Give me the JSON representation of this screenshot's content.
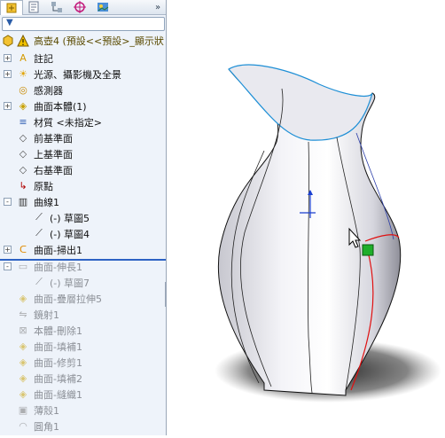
{
  "tree": {
    "root": "高壺4 (預設<<預設>_顯示狀",
    "items": [
      {
        "label": "註記",
        "icon": "A",
        "expand": "+"
      },
      {
        "label": "光源、攝影機及全景",
        "icon": "☀",
        "expand": "+"
      },
      {
        "label": "感測器",
        "icon": "◎",
        "expand": ""
      },
      {
        "label": "曲面本體(1)",
        "icon": "◈",
        "expand": "+"
      },
      {
        "label": "材質 <未指定>",
        "icon": "≡",
        "expand": ""
      },
      {
        "label": "前基準面",
        "icon": "◇",
        "expand": ""
      },
      {
        "label": "上基準面",
        "icon": "◇",
        "expand": ""
      },
      {
        "label": "右基準面",
        "icon": "◇",
        "expand": ""
      },
      {
        "label": "原點",
        "icon": "↳",
        "expand": ""
      },
      {
        "label": "曲線1",
        "icon": "▥",
        "expand": "-"
      },
      {
        "label": "(-) 草圖5",
        "icon": "⟋",
        "expand": ""
      },
      {
        "label": "(-) 草圖4",
        "icon": "⟋",
        "expand": ""
      },
      {
        "label": "曲面-掃出1",
        "icon": "ᑕ",
        "expand": "+"
      }
    ],
    "suppressed": [
      {
        "label": "曲面-伸長1",
        "icon": "▭",
        "expand": "-"
      },
      {
        "label": "(-) 草圖7",
        "icon": "⟋",
        "expand": ""
      },
      {
        "label": "曲面-疊層拉伸5",
        "icon": "◈",
        "expand": ""
      },
      {
        "label": "鏡射1",
        "icon": "⇋",
        "expand": ""
      },
      {
        "label": "本體-刪除1",
        "icon": "⊠",
        "expand": ""
      },
      {
        "label": "曲面-填補1",
        "icon": "◈",
        "expand": ""
      },
      {
        "label": "曲面-修剪1",
        "icon": "◈",
        "expand": ""
      },
      {
        "label": "曲面-填補2",
        "icon": "◈",
        "expand": ""
      },
      {
        "label": "曲面-縫織1",
        "icon": "◈",
        "expand": ""
      },
      {
        "label": "薄殼1",
        "icon": "▣",
        "expand": ""
      },
      {
        "label": "圓角1",
        "icon": "◠",
        "expand": ""
      }
    ]
  },
  "colors": {
    "accent": "#2d62c4",
    "warning": "#f2c200",
    "sketch_blue": "#1a3fd0",
    "edge_red": "#e01010",
    "handle_green": "#1fae2a"
  }
}
